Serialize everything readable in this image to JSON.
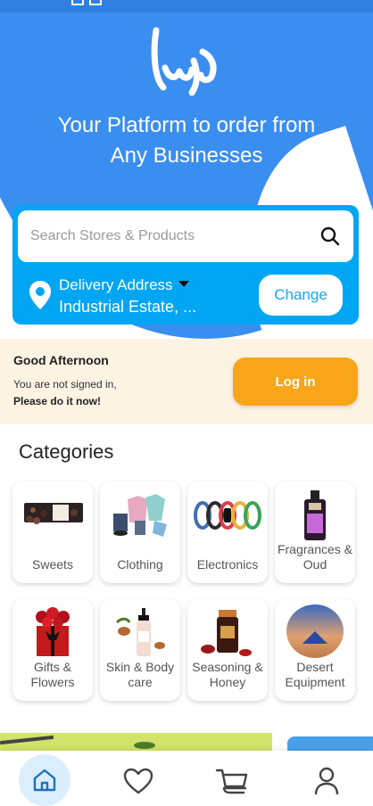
{
  "header": {
    "logo_alt": "سمزا",
    "tagline_line1": "Your Platform to order from",
    "tagline_line2": "Any Businesses"
  },
  "search": {
    "placeholder": "Search Stores & Products"
  },
  "delivery": {
    "label": "Delivery Address",
    "value": "Industrial Estate, ...",
    "change_label": "Change"
  },
  "greeting": {
    "title": "Good Afternoon",
    "subtitle": "You are not signed in,",
    "prompt": "Please do it now!",
    "login_label": "Log in"
  },
  "categories": {
    "title": "Categories",
    "items": [
      {
        "label": "Sweets",
        "icon": "sweets-box-icon"
      },
      {
        "label": "Clothing",
        "icon": "clothing-icon"
      },
      {
        "label": "Electronics",
        "icon": "smartwatch-bands-icon"
      },
      {
        "label": "Fragrances & Oud",
        "icon": "perfume-bottle-icon"
      },
      {
        "label": "Gifts & Flowers",
        "icon": "rose-box-icon"
      },
      {
        "label": "Skin & Body care",
        "icon": "lotion-bottle-icon"
      },
      {
        "label": "Seasoning & Honey",
        "icon": "spice-jar-icon"
      },
      {
        "label": "Desert Equipment",
        "icon": "tent-icon"
      }
    ]
  },
  "nav": {
    "items": [
      {
        "name": "home",
        "icon": "home-icon",
        "active": true
      },
      {
        "name": "favorites",
        "icon": "heart-icon",
        "active": false
      },
      {
        "name": "cart",
        "icon": "cart-icon",
        "active": false
      },
      {
        "name": "profile",
        "icon": "user-icon",
        "active": false
      }
    ]
  },
  "colors": {
    "primary_blue": "#3a8ef0",
    "search_card": "#00a6f4",
    "login_orange": "#f9a51a",
    "greeting_bg": "#fdf3e3",
    "nav_active_bg": "#dbeefb"
  }
}
